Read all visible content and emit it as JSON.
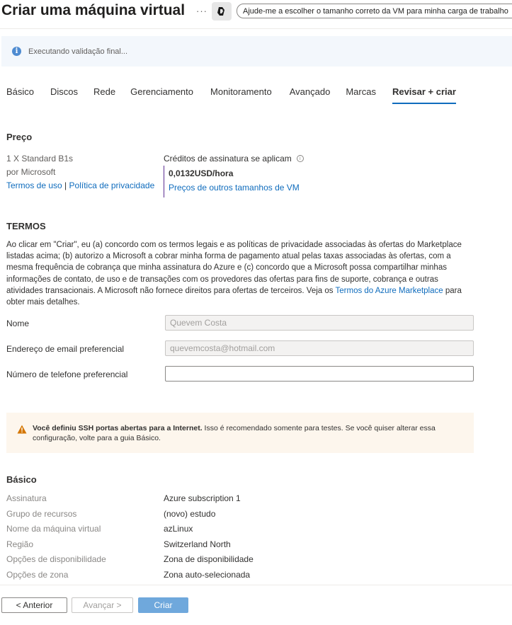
{
  "header": {
    "title": "Criar uma máquina virtual",
    "more": "···",
    "help_button": "Ajude-me a escolher o tamanho correto da VM para minha carga de trabalho"
  },
  "banner": {
    "text": "Executando validação final..."
  },
  "tabs": [
    {
      "label": "Básico"
    },
    {
      "label": "Discos"
    },
    {
      "label": "Rede"
    },
    {
      "label": "Gerenciamento"
    },
    {
      "label": "Monitoramento"
    },
    {
      "label": "Avançado"
    },
    {
      "label": "Marcas"
    },
    {
      "label": "Revisar + criar"
    }
  ],
  "price": {
    "title": "Preço",
    "product": "1 X Standard B1s",
    "vendor": "por Microsoft",
    "terms_link": "Termos de uso",
    "separator": "|",
    "privacy_link": "Política de privacidade",
    "credits_label": "Créditos de assinatura se aplicam",
    "value": "0,0132USD/hora",
    "other_sizes_link": "Preços de outros tamanhos de VM"
  },
  "terms": {
    "title": "TERMOS",
    "text_before": "Ao clicar em \"Criar\", eu (a) concordo com os termos legais e as políticas de privacidade associadas às ofertas do Marketplace listadas acima; (b) autorizo a Microsoft a cobrar minha forma de pagamento atual pelas taxas associadas às ofertas, com a mesma frequência de cobrança que minha assinatura do Azure e (c) concordo que a Microsoft possa compartilhar minhas informações de contato, de uso e de transações com os provedores das ofertas para fins de suporte, cobrança e outras atividades transacionais. A Microsoft não fornece direitos para ofertas de terceiros. Veja os ",
    "link": "Termos do Azure Marketplace",
    "text_after": " para obter mais detalhes."
  },
  "form": {
    "name_label": "Nome",
    "name_value": "Quevem Costa",
    "email_label": "Endereço de email preferencial",
    "email_value": "quevemcosta@hotmail.com",
    "phone_label": "Número de telefone preferencial",
    "phone_value": ""
  },
  "warning": {
    "bold": "Você definiu SSH portas abertas para a Internet.",
    "text": "  Isso é recomendado somente para testes.  Se você quiser alterar essa configuração, volte para a guia Básico."
  },
  "summary": {
    "title": "Básico",
    "rows": [
      {
        "label": "Assinatura",
        "value": "Azure subscription 1"
      },
      {
        "label": "Grupo de recursos",
        "value": "(novo) estudo"
      },
      {
        "label": "Nome da máquina virtual",
        "value": "azLinux"
      },
      {
        "label": "Região",
        "value": "Switzerland North"
      },
      {
        "label": "Opções de disponibilidade",
        "value": "Zona de disponibilidade"
      },
      {
        "label": "Opções de zona",
        "value": "Zona auto-selecionada"
      }
    ]
  },
  "footer": {
    "prev": "< Anterior",
    "next": "Avançar >",
    "create": "Criar"
  },
  "colors": {
    "accent": "#0f6cbd",
    "price_bar": "#5c2e91",
    "warning_bg": "#fdf6ed",
    "create_button": "#6fa8dc"
  }
}
